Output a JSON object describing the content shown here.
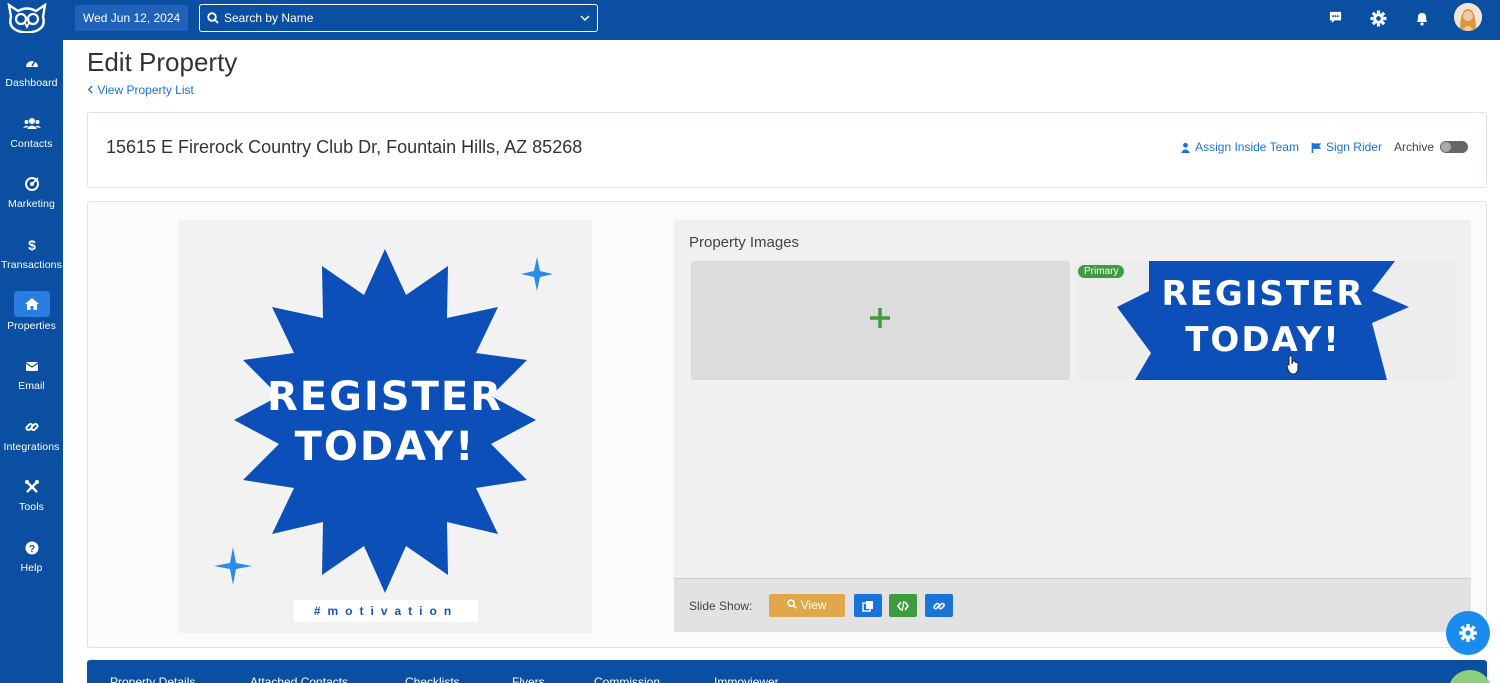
{
  "topbar": {
    "date": "Wed Jun 12, 2024",
    "search_placeholder": "Search by Name"
  },
  "sidebar": {
    "items": [
      {
        "label": "Dashboard",
        "icon": "dashboard-icon"
      },
      {
        "label": "Contacts",
        "icon": "users-icon"
      },
      {
        "label": "Marketing",
        "icon": "target-icon"
      },
      {
        "label": "Transactions",
        "icon": "dollar-icon"
      },
      {
        "label": "Properties",
        "icon": "home-icon"
      },
      {
        "label": "Email",
        "icon": "envelope-icon"
      },
      {
        "label": "Integrations",
        "icon": "link-icon"
      },
      {
        "label": "Tools",
        "icon": "tools-icon"
      },
      {
        "label": "Help",
        "icon": "help-icon"
      }
    ],
    "active": "Properties"
  },
  "page": {
    "title": "Edit Property",
    "back_link": "View Property List"
  },
  "property": {
    "address": "15615 E Firerock Country Club Dr, Fountain Hills, AZ 85268",
    "assign_label": "Assign Inside Team",
    "sign_rider_label": "Sign Rider",
    "archive_label": "Archive",
    "archived": false
  },
  "hero": {
    "line1": "REGISTER",
    "line2": "TODAY!",
    "tag": "#motivation"
  },
  "images": {
    "title": "Property Images",
    "primary_badge": "Primary",
    "thumb_line1": "REGISTER",
    "thumb_line2": "TODAY!"
  },
  "slideshow": {
    "label": "Slide Show:",
    "view_label": "View"
  },
  "tabs": [
    "Property Details",
    "Attached Contacts",
    "Checklists",
    "Flyers",
    "Commission",
    "Immoviewer"
  ],
  "colors": {
    "brand": "#0a4fa1",
    "accent": "#1a73d9",
    "view_button": "#e0a84a",
    "embed_button": "#3f9b3f",
    "primary_badge": "#3f9b3f",
    "badge_blue": "#1553b8"
  }
}
